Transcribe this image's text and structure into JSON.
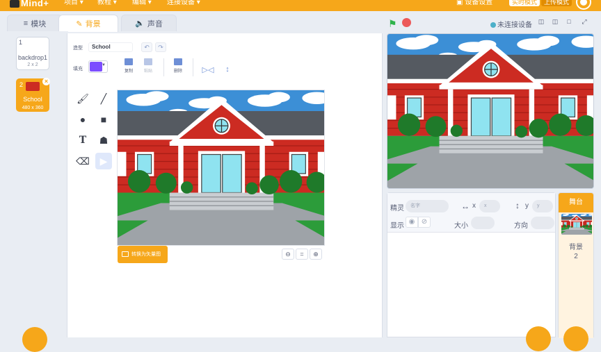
{
  "app": {
    "logo": "Mind+",
    "menus": [
      "项目",
      "教程",
      "编辑",
      "连接设备"
    ],
    "right_items": [
      "设备设置"
    ],
    "modes": {
      "realtime": "实时模式",
      "upload": "上传模式"
    }
  },
  "tabs": [
    {
      "label": "模块",
      "icon": "blocks-icon"
    },
    {
      "label": "背景",
      "icon": "brush-icon"
    },
    {
      "label": "声音",
      "icon": "speaker-icon"
    }
  ],
  "costumes": [
    {
      "index": "1",
      "name": "backdrop1",
      "size": "2 x 2"
    },
    {
      "index": "2",
      "name": "School",
      "size": "480 x 360",
      "selected": true
    }
  ],
  "editor": {
    "name_label": "造型",
    "name_value": "School",
    "fill_label": "填充",
    "fill_color": "#7c4dff",
    "toolbar": {
      "copy": "复制",
      "paste": "粘贴",
      "delete": "删除"
    },
    "convert_label": "转换为矢量图",
    "zoom": {
      "out": "−",
      "reset": "=",
      "in": "+"
    }
  },
  "stage_header": {
    "device_status": "未连接设备"
  },
  "sprite_info": {
    "sprite_label": "精灵",
    "name_placeholder": "名字",
    "x_label": "x",
    "x_placeholder": "x",
    "y_label": "y",
    "y_placeholder": "y",
    "show_label": "显示",
    "size_label": "大小",
    "direction_label": "方向"
  },
  "stage_pane": {
    "title": "舞台",
    "backdrops_label": "背景",
    "backdrops_count": "2"
  },
  "colors": {
    "accent": "#f6a71a",
    "flag": "#2fb34b",
    "stop": "#ec5959",
    "house_red": "#cc2b22",
    "sky": "#3c8fd6"
  }
}
